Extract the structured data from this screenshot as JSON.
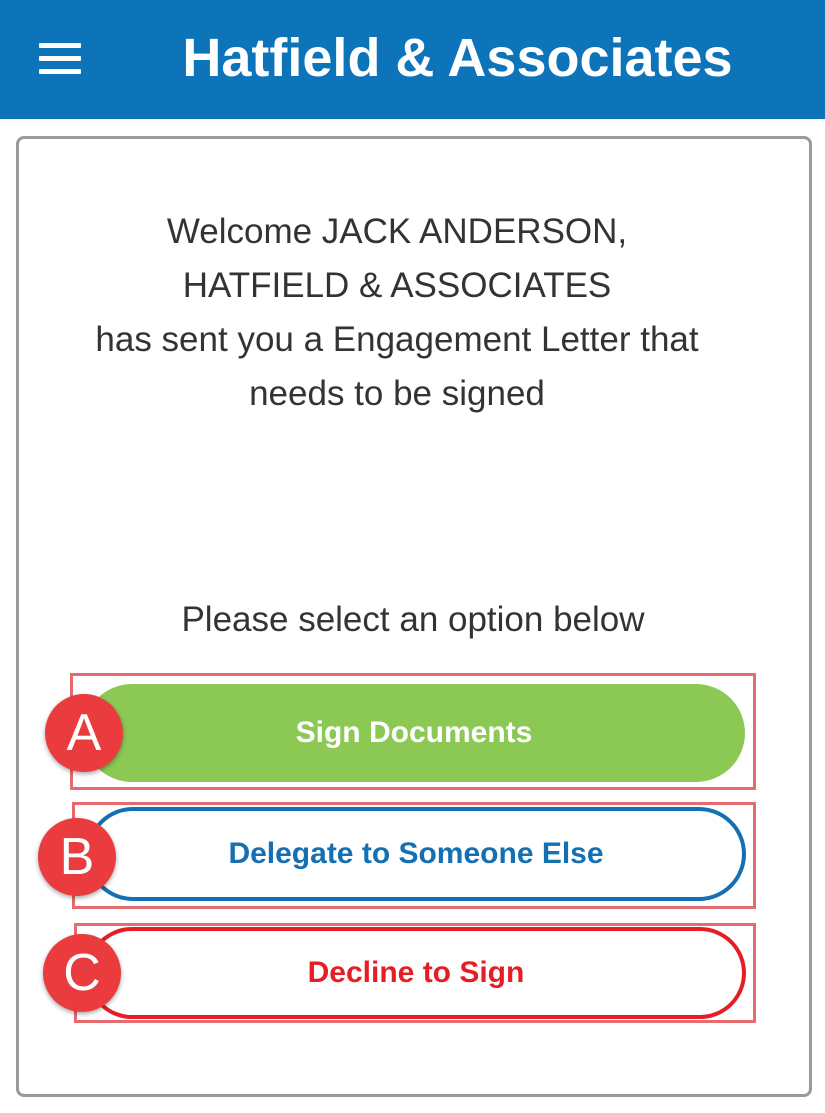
{
  "header": {
    "title": "Hatfield & Associates",
    "menu_icon": "hamburger-menu-icon",
    "background_color": "#0d74ba"
  },
  "welcome": {
    "line1": "Welcome JACK ANDERSON,",
    "line2": "HATFIELD & ASSOCIATES",
    "line3": "has sent you a Engagement Letter that",
    "line4": "needs to be signed"
  },
  "prompt": "Please select an option below",
  "options": [
    {
      "badge": "A",
      "label": "Sign Documents",
      "color": "#8bc954"
    },
    {
      "badge": "B",
      "label": "Delegate to Someone Else",
      "color": "#1470b2"
    },
    {
      "badge": "C",
      "label": "Decline to Sign",
      "color": "#e61d24"
    }
  ],
  "annotation_color": "#ea3c3f"
}
